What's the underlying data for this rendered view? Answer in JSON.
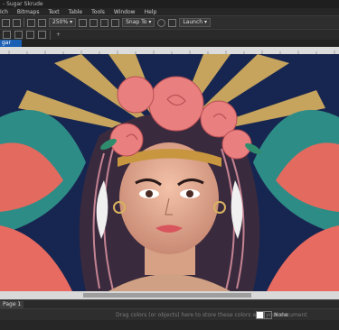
{
  "app": {
    "title": "- Sugar Skrude"
  },
  "menu": {
    "items": [
      "Ich",
      "Bitmaps",
      "Text",
      "Table",
      "Tools",
      "Window",
      "Help"
    ]
  },
  "toolbar": {
    "zoom": "250%",
    "snap": "Snap To",
    "launch": "Launch"
  },
  "document": {
    "tab_label": "gar"
  },
  "pages": {
    "current": "Page 1"
  },
  "status": {
    "hint": "Drag colors (or objects) here to store these colors with your document",
    "stroke_label": "None"
  },
  "colors": {
    "accent": "#1a5fb4"
  }
}
